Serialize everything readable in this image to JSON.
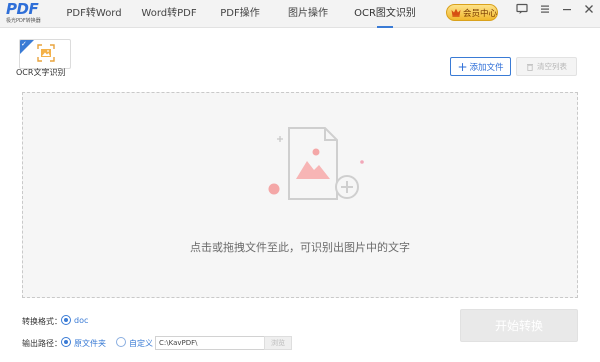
{
  "app": {
    "logo_text": "PDF",
    "logo_subtitle": "极光PDF转换器",
    "brand_color": "#2f6fd8"
  },
  "nav": {
    "tabs": [
      {
        "label": "PDF转Word",
        "active": false
      },
      {
        "label": "Word转PDF",
        "active": false
      },
      {
        "label": "PDF操作",
        "active": false
      },
      {
        "label": "图片操作",
        "active": false
      },
      {
        "label": "OCR图文识别",
        "active": true
      }
    ]
  },
  "vip": {
    "label": "会员中心"
  },
  "window_controls": [
    "feedback-icon",
    "menu-icon",
    "minimize-icon",
    "close-icon"
  ],
  "tool": {
    "label": "OCR文字识别"
  },
  "toolbar": {
    "add_label": "添加文件",
    "clear_label": "清空列表"
  },
  "dropzone": {
    "hint": "点击或拖拽文件至此，可识别出图片中的文字"
  },
  "settings": {
    "format_label": "转换格式：",
    "format_option": "doc",
    "output_label": "输出路径：",
    "output_option_source": "原文件夹",
    "output_option_custom": "自定义",
    "path_value": "C:\\KavPDF\\",
    "browse_label": "浏览"
  },
  "start": {
    "label": "开始转换"
  }
}
